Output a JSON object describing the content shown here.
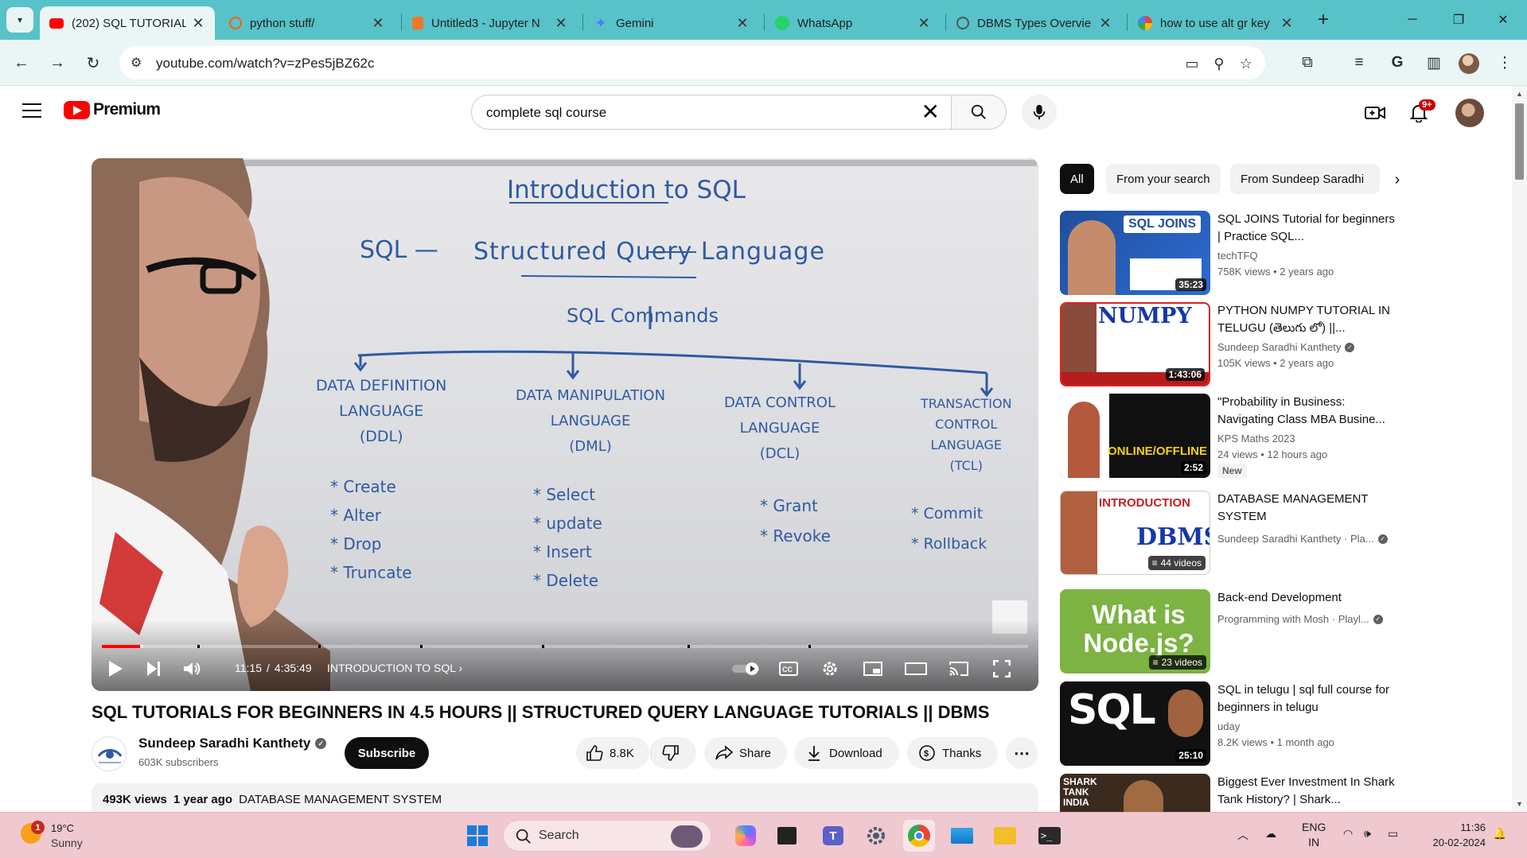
{
  "browser": {
    "tabs": [
      {
        "title": "(202) SQL TUTORIALS",
        "active": true,
        "favicon": "youtube-icon"
      },
      {
        "title": "python stuff/",
        "active": false,
        "favicon": "replit-icon"
      },
      {
        "title": "Untitled3 - Jupyter N",
        "active": false,
        "favicon": "jupyter-icon"
      },
      {
        "title": "Gemini",
        "active": false,
        "favicon": "gemini-icon"
      },
      {
        "title": "WhatsApp",
        "active": false,
        "favicon": "whatsapp-icon"
      },
      {
        "title": "DBMS Types Overvie",
        "active": false,
        "favicon": "chatgpt-icon"
      },
      {
        "title": "how to use alt gr key",
        "active": false,
        "favicon": "google-icon"
      }
    ],
    "url": "youtube.com/watch?v=zPes5jBZ62c"
  },
  "youtube": {
    "logo_text": "Premium",
    "search_value": "complete sql course",
    "notification_count": "9+"
  },
  "player": {
    "current_time": "11:15",
    "duration": "4:35:49",
    "time_separator": "/",
    "chapter": "INTRODUCTION TO SQL",
    "played_fraction": 0.041,
    "buffered_fraction": 0.045,
    "board": {
      "heading": "Introduction to SQL",
      "sql_label": "SQL —",
      "expansion": "Structured Query Language",
      "commands_heading": "SQL Commands",
      "categories": [
        {
          "name_lines": [
            "DATA DEFINITION",
            "LANGUAGE",
            "(DDL)"
          ],
          "items": [
            "* Create",
            "* Alter",
            "* Drop",
            "* Truncate"
          ]
        },
        {
          "name_lines": [
            "DATA MANIPULATION",
            "LANGUAGE",
            "(DML)"
          ],
          "items": [
            "* Select",
            "* update",
            "* Insert",
            "* Delete"
          ]
        },
        {
          "name_lines": [
            "DATA CONTROL",
            "LANGUAGE",
            "(DCL)"
          ],
          "items": [
            "* Grant",
            "* Revoke"
          ]
        },
        {
          "name_lines": [
            "TRANSACTION",
            "CONTROL",
            "LANGUAGE",
            "(TCL)"
          ],
          "items": [
            "* Commit",
            "* Rollback"
          ]
        }
      ]
    }
  },
  "video": {
    "title": "SQL TUTORIALS FOR BEGINNERS IN 4.5 HOURS || STRUCTURED QUERY LANGUAGE TUTORIALS || DBMS",
    "channel": "Sundeep Saradhi Kanthety",
    "subscribers": "603K subscribers",
    "subscribe_label": "Subscribe",
    "likes": "8.8K",
    "share_label": "Share",
    "download_label": "Download",
    "thanks_label": "Thanks",
    "views": "493K views",
    "age": "1 year ago",
    "playlist_tag": "DATABASE MANAGEMENT SYSTEM"
  },
  "sidebar": {
    "chips": [
      "All",
      "From your search",
      "From Sundeep Saradhi"
    ],
    "items": [
      {
        "title": "SQL JOINS Tutorial for beginners | Practice SQL...",
        "channel": "techTFQ",
        "verified": false,
        "meta": "758K views • 2 years ago",
        "duration": "35:23",
        "thumb_text": "SQL JOINS"
      },
      {
        "title": "PYTHON NUMPY TUTORIAL IN TELUGU (తెలుగు లో) ||...",
        "channel": "Sundeep Saradhi Kanthety",
        "verified": true,
        "meta": "105K views • 2 years ago",
        "duration": "1:43:06",
        "thumb_text": "NUMPY"
      },
      {
        "title": "\"Probability in Business: Navigating Class MBA Busine...",
        "channel": "KPS Maths 2023",
        "verified": false,
        "meta": "24 views • 12 hours ago",
        "duration": "2:52",
        "badge": "New",
        "thumb_text": "ONLINE/OFFLINE"
      },
      {
        "title": "DATABASE MANAGEMENT SYSTEM",
        "channel": "Sundeep Saradhi Kanthety · Pla...",
        "verified": true,
        "meta": "",
        "playlist_count": "44 videos",
        "thumb_text": "DBMS"
      },
      {
        "title": "Back-end Development",
        "channel": "Programming with Mosh · Playl...",
        "verified": true,
        "meta": "",
        "playlist_count": "23 videos",
        "thumb_text": "What is Node.js?"
      },
      {
        "title": "SQL in telugu | sql full course for beginners in telugu",
        "channel": "uday",
        "verified": false,
        "meta": "8.2K views • 1 month ago",
        "duration": "25:10",
        "thumb_text": "SQL"
      },
      {
        "title": "Biggest Ever Investment In Shark Tank History? | Shark...",
        "channel": "",
        "verified": false,
        "meta": "",
        "thumb_text": "SHARK TANK INDIA"
      }
    ]
  },
  "taskbar": {
    "weather_temp": "19°C",
    "weather_cond": "Sunny",
    "weather_badge": "1",
    "search_label": "Search",
    "lang": "ENG",
    "region": "IN",
    "time": "11:36",
    "date": "20-02-2024"
  },
  "colors": {
    "tabstrip": "#57c2c7",
    "toolbar": "#eaf6f6",
    "youtube_red": "#ff0000",
    "board_ink": "#2f5aa3",
    "taskbar": "#f0c8cf"
  }
}
